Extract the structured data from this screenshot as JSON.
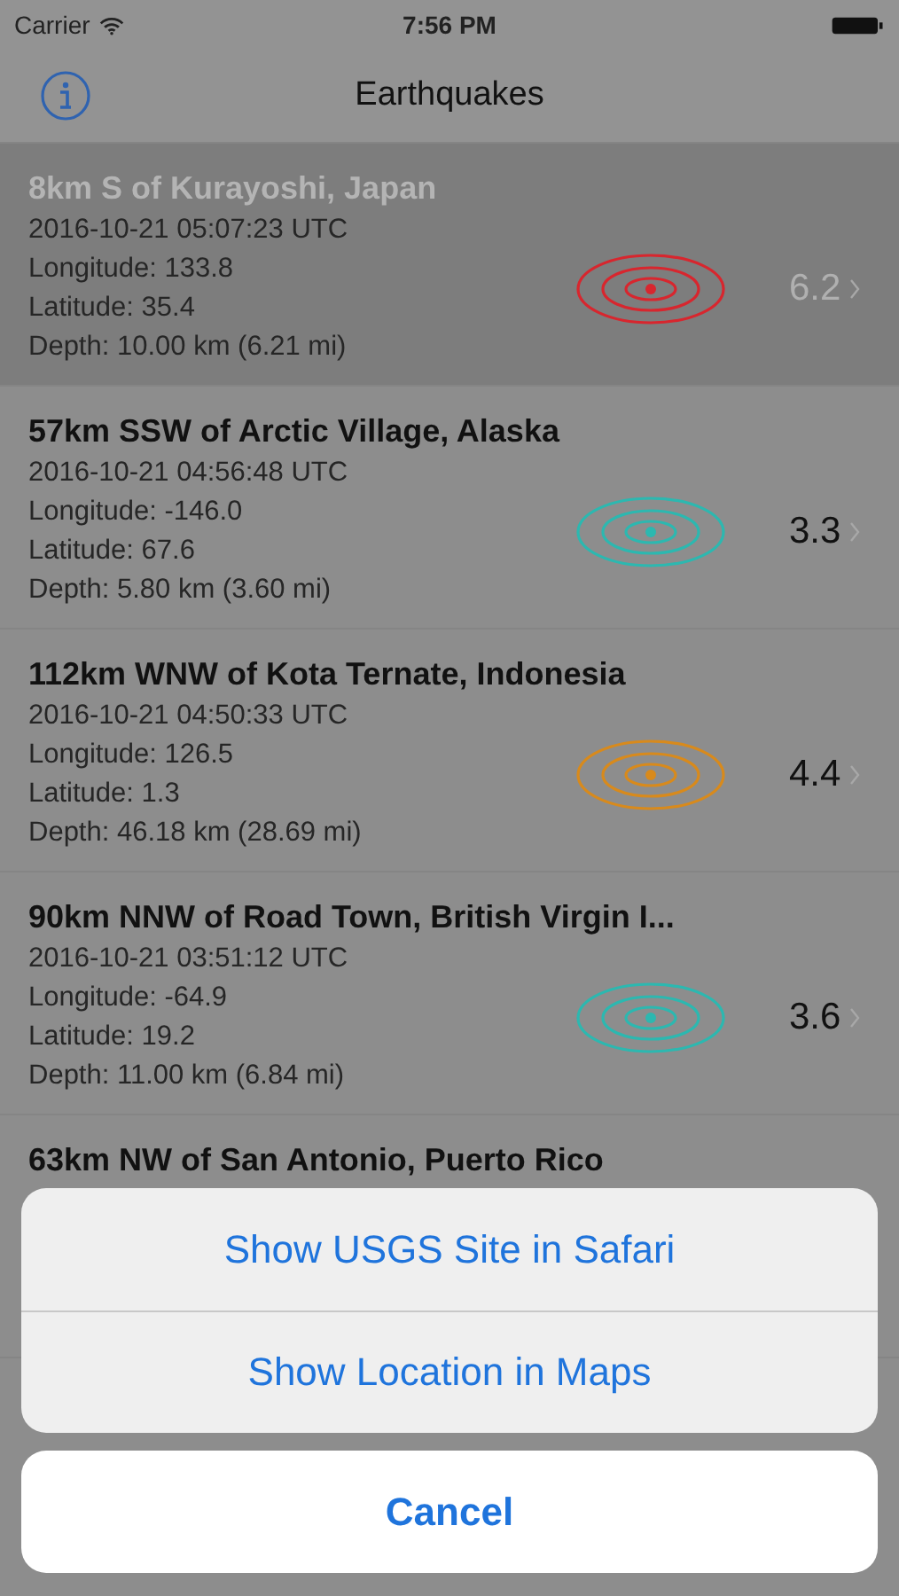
{
  "status_bar": {
    "carrier": "Carrier",
    "time": "7:56 PM"
  },
  "nav_bar": {
    "title": "Earthquakes"
  },
  "quakes": [
    {
      "place": "8km S of Kurayoshi, Japan",
      "time": "2016-10-21 05:07:23 UTC",
      "longitude": "Longitude: 133.8",
      "latitude": "Latitude: 35.4",
      "depth": "Depth: 10.00 km (6.21 mi)",
      "magnitude": "6.2",
      "color": "#d8262e",
      "selected": true
    },
    {
      "place": "57km SSW of Arctic Village, Alaska",
      "time": "2016-10-21 04:56:48 UTC",
      "longitude": "Longitude: -146.0",
      "latitude": "Latitude: 67.6",
      "depth": "Depth: 5.80 km (3.60 mi)",
      "magnitude": "3.3",
      "color": "#2cb8b0",
      "selected": false
    },
    {
      "place": "112km WNW of Kota Ternate, Indonesia",
      "time": "2016-10-21 04:50:33 UTC",
      "longitude": "Longitude: 126.5",
      "latitude": "Latitude: 1.3",
      "depth": "Depth: 46.18 km (28.69 mi)",
      "magnitude": "4.4",
      "color": "#d88a1c",
      "selected": false
    },
    {
      "place": "90km NNW of Road Town, British Virgin I...",
      "time": "2016-10-21 03:51:12 UTC",
      "longitude": "Longitude: -64.9",
      "latitude": "Latitude: 19.2",
      "depth": "Depth: 11.00 km (6.84 mi)",
      "magnitude": "3.6",
      "color": "#2cb8b0",
      "selected": false
    },
    {
      "place": "63km NW of San Antonio, Puerto Rico"
    }
  ],
  "action_sheet": {
    "actions": [
      "Show USGS Site in Safari",
      "Show Location in Maps"
    ],
    "cancel": "Cancel"
  }
}
